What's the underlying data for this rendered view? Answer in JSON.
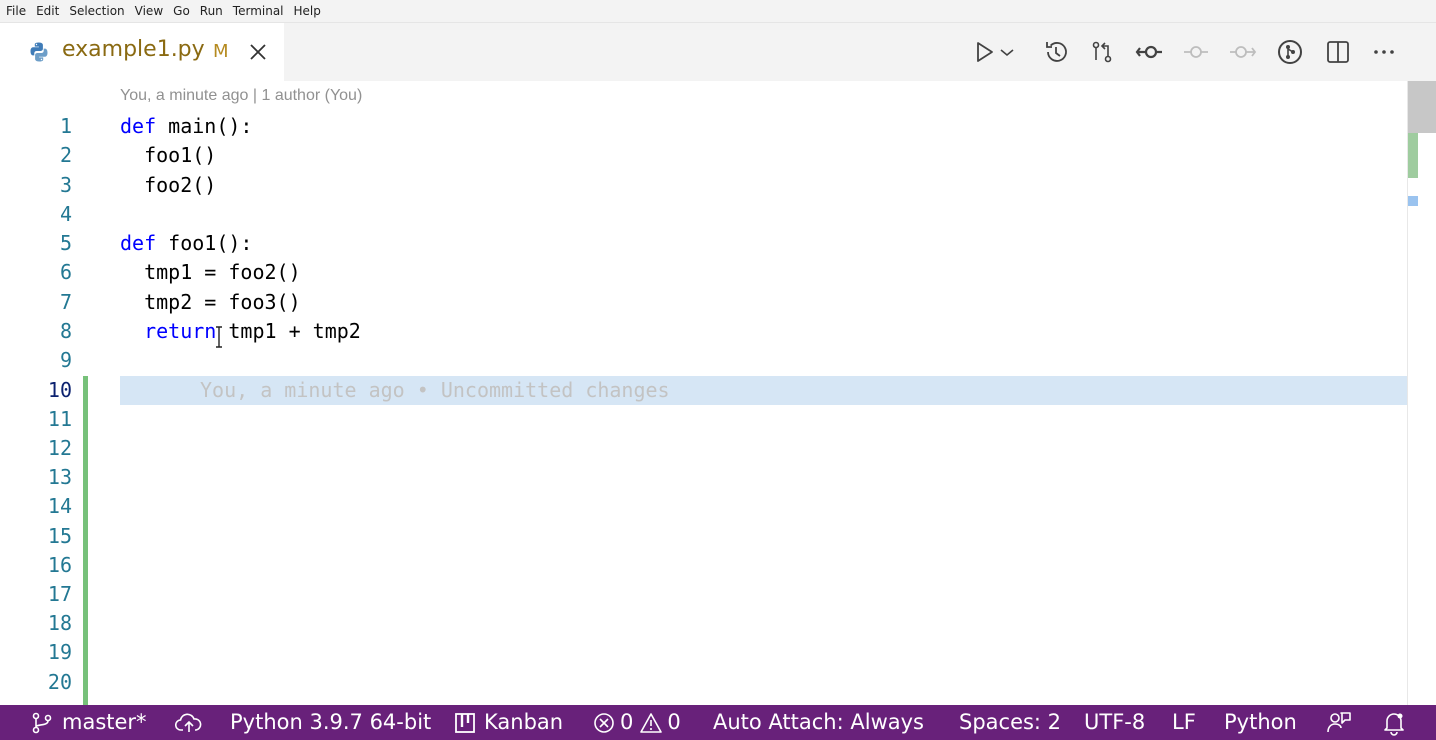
{
  "menu": [
    "File",
    "Edit",
    "Selection",
    "View",
    "Go",
    "Run",
    "Terminal",
    "Help"
  ],
  "tab": {
    "filename": "example1.py",
    "status": "M",
    "icon": "python-icon"
  },
  "toolbar": {
    "icons": [
      "run-icon",
      "dropdown-icon",
      "timeline-icon",
      "compare-changes-icon",
      "commit-icon",
      "previous-revision-icon",
      "next-revision-icon",
      "git-lens-icon",
      "split-editor-icon",
      "more-actions-icon"
    ]
  },
  "editor": {
    "codelens": {
      "author_time": "You, a minute ago",
      "separator": "|",
      "authors": "1 author (You)"
    },
    "line_numbers": [
      "1",
      "2",
      "3",
      "4",
      "5",
      "6",
      "7",
      "8",
      "9",
      "10",
      "11",
      "12",
      "13",
      "14",
      "15",
      "16",
      "17",
      "18",
      "19",
      "20"
    ],
    "active_line": "10",
    "lines": [
      {
        "kw": "def",
        "rest": " main():"
      },
      {
        "kw": "",
        "rest": "  foo1()"
      },
      {
        "kw": "",
        "rest": "  foo2()"
      },
      {
        "kw": "",
        "rest": ""
      },
      {
        "kw": "def",
        "rest": " foo1():"
      },
      {
        "kw": "",
        "rest": "  tmp1 = foo2()"
      },
      {
        "kw": "",
        "rest": "  tmp2 = foo3()"
      },
      {
        "kw": "return",
        "rest": " tmp1 + tmp2",
        "indent": "  "
      }
    ],
    "inline_blame": "You, a minute ago • Uncommitted changes"
  },
  "statusbar": {
    "branch": "master*",
    "python": "Python 3.9.7 64-bit",
    "kanban": "Kanban",
    "errors": "0",
    "warnings": "0",
    "auto_attach": "Auto Attach: Always",
    "spaces": "Spaces: 2",
    "encoding": "UTF-8",
    "eol": "LF",
    "language": "Python"
  },
  "colors": {
    "statusbar_bg": "#68217a",
    "keyword": "#0000ff",
    "line_number": "#237893",
    "current_line_bg": "#d6e6f5",
    "diff_added": "#77c17a"
  }
}
